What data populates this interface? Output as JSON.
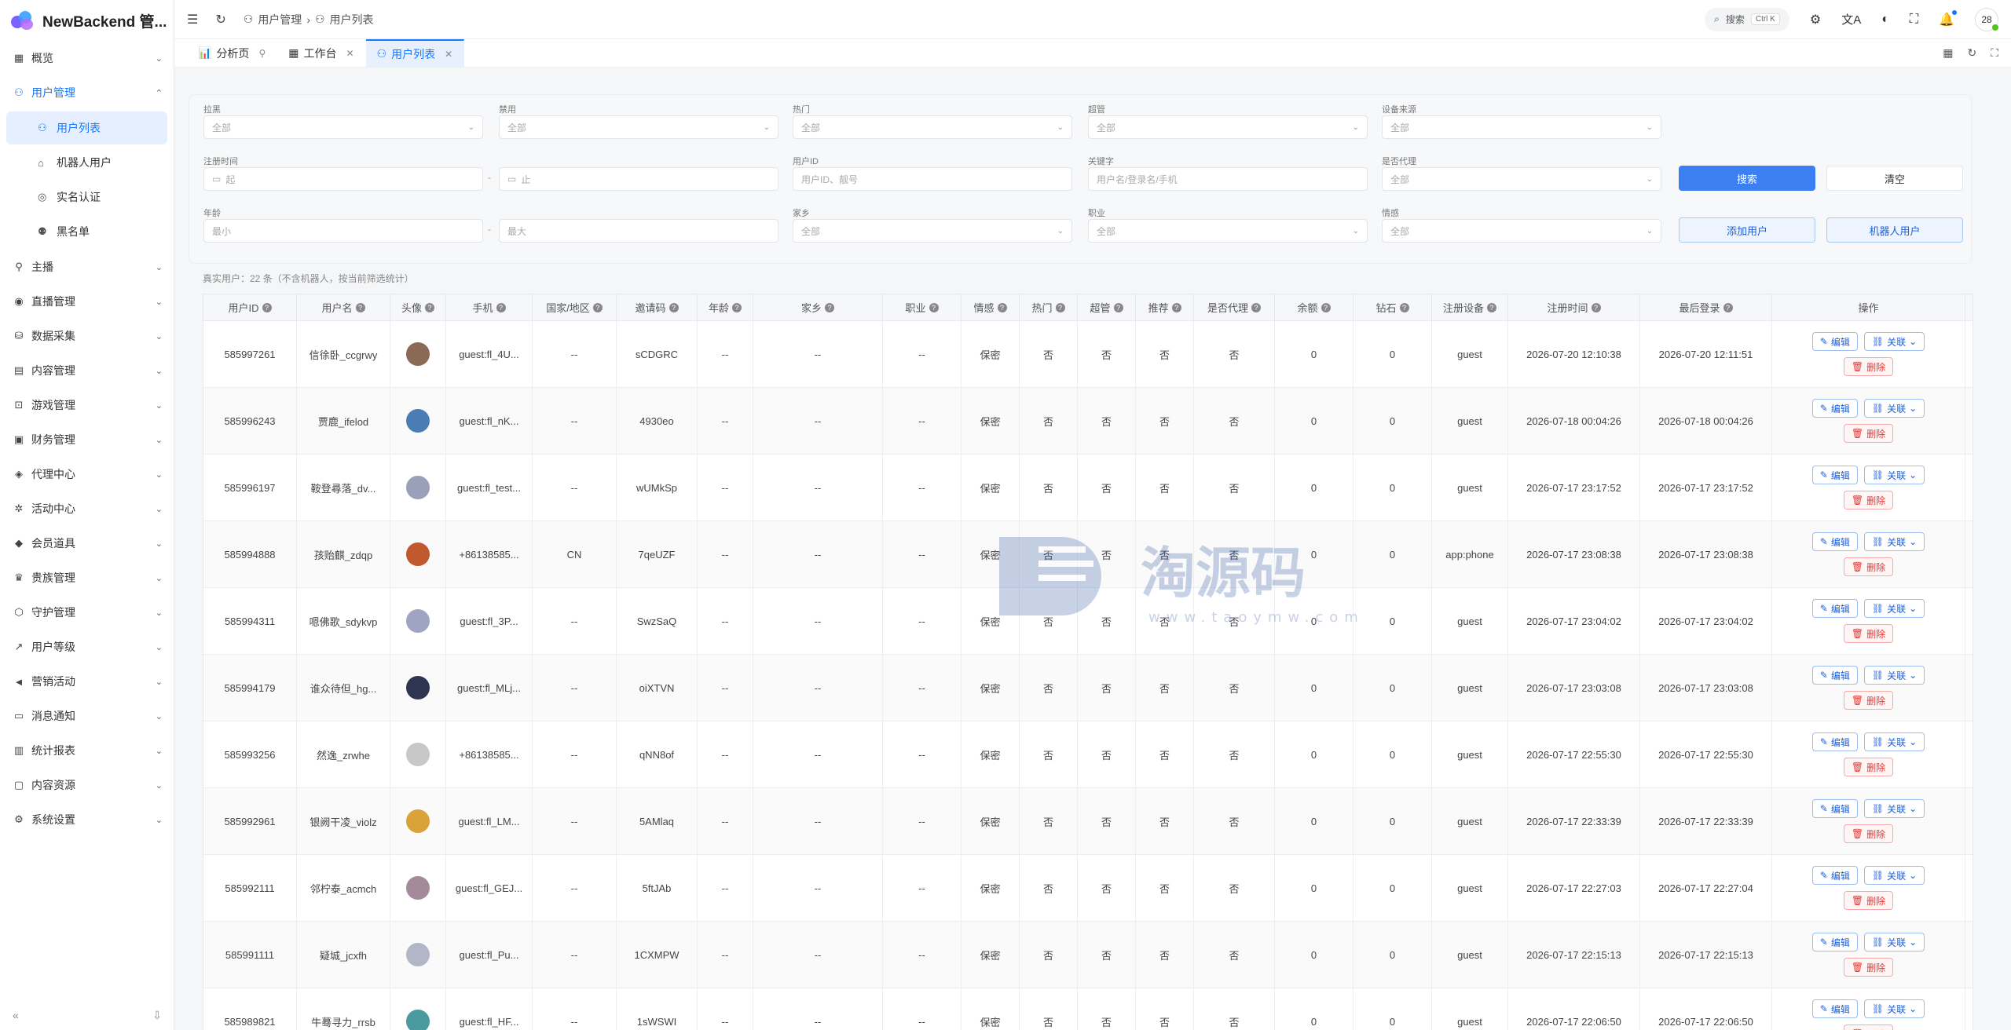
{
  "app": {
    "title": "NewBackend 管...",
    "colors": {
      "accent": "#1677ff",
      "primary_btn": "#3b7ff3",
      "danger": "#e53935"
    }
  },
  "sidebar": {
    "items": [
      {
        "label": "概览",
        "icon": "dashboard-icon"
      },
      {
        "label": "用户管理",
        "icon": "user-icon",
        "expanded": true,
        "children": [
          {
            "label": "用户列表",
            "icon": "user-icon",
            "active": true
          },
          {
            "label": "机器人用户",
            "icon": "robot-icon"
          },
          {
            "label": "实名认证",
            "icon": "fingerprint-icon"
          },
          {
            "label": "黑名单",
            "icon": "user-block-icon"
          }
        ]
      },
      {
        "label": "主播",
        "icon": "mic-icon"
      },
      {
        "label": "直播管理",
        "icon": "broadcast-icon"
      },
      {
        "label": "数据采集",
        "icon": "database-icon"
      },
      {
        "label": "内容管理",
        "icon": "content-icon"
      },
      {
        "label": "游戏管理",
        "icon": "gamepad-icon"
      },
      {
        "label": "财务管理",
        "icon": "wallet-icon"
      },
      {
        "label": "代理中心",
        "icon": "shield-icon"
      },
      {
        "label": "活动中心",
        "icon": "gift-icon"
      },
      {
        "label": "会员道具",
        "icon": "diamond-icon"
      },
      {
        "label": "贵族管理",
        "icon": "crown-icon"
      },
      {
        "label": "守护管理",
        "icon": "guard-icon"
      },
      {
        "label": "用户等级",
        "icon": "trend-icon"
      },
      {
        "label": "营销活动",
        "icon": "megaphone-icon"
      },
      {
        "label": "消息通知",
        "icon": "message-icon"
      },
      {
        "label": "统计报表",
        "icon": "chart-icon"
      },
      {
        "label": "内容资源",
        "icon": "folder-icon"
      },
      {
        "label": "系统设置",
        "icon": "gear-icon"
      }
    ],
    "collapse": "«",
    "pin": "⇩"
  },
  "topbar": {
    "breadcrumb": [
      "用户管理",
      "用户列表"
    ],
    "search_label": "搜索",
    "search_kbd": "Ctrl K",
    "avatar_text": "28"
  },
  "tabs": [
    {
      "label": "分析页",
      "icon": "chart-icon",
      "pin": true
    },
    {
      "label": "工作台",
      "icon": "grid-icon",
      "closable": true
    },
    {
      "label": "用户列表",
      "icon": "user-icon",
      "closable": true,
      "active": true
    }
  ],
  "filters": {
    "row1": [
      {
        "label": "拉黑",
        "placeholder": "全部",
        "type": "select"
      },
      {
        "label": "禁用",
        "placeholder": "全部",
        "type": "select"
      },
      {
        "label": "热门",
        "placeholder": "全部",
        "type": "select"
      },
      {
        "label": "超管",
        "placeholder": "全部",
        "type": "select"
      },
      {
        "label": "设备来源",
        "placeholder": "全部",
        "type": "select"
      }
    ],
    "reg_time": {
      "label": "注册时间",
      "start": "起",
      "end": "止",
      "sep": "-"
    },
    "user_id": {
      "label": "用户ID",
      "placeholder": "用户ID、靓号"
    },
    "keyword": {
      "label": "关键字",
      "placeholder": "用户名/登录名/手机"
    },
    "is_agent": {
      "label": "是否代理",
      "placeholder": "全部"
    },
    "age": {
      "label": "年龄",
      "min": "最小",
      "max": "最大",
      "sep": "-"
    },
    "hometown": {
      "label": "家乡",
      "placeholder": "全部"
    },
    "job": {
      "label": "职业",
      "placeholder": "全部"
    },
    "emotion": {
      "label": "情感",
      "placeholder": "全部"
    },
    "search_btn": "搜索",
    "clear_btn": "清空",
    "add_btn": "添加用户",
    "robot_btn": "机器人用户"
  },
  "summary": "真实用户：22 条（不含机器人，按当前筛选统计）",
  "table": {
    "columns": [
      "用户ID",
      "用户名",
      "头像",
      "手机",
      "国家/地区",
      "邀请码",
      "年龄",
      "家乡",
      "职业",
      "情感",
      "热门",
      "超管",
      "推荐",
      "是否代理",
      "余额",
      "钻石",
      "注册设备",
      "注册时间",
      "最后登录",
      "操作"
    ],
    "ops": {
      "edit": "编辑",
      "link": "关联",
      "delete": "删除"
    },
    "rows": [
      {
        "id": "585997261",
        "name": "信徐卧_ccgrwy",
        "avatar": "#8a6a55",
        "phone": "guest:fl_4U...",
        "region": "--",
        "invite": "sCDGRC",
        "age": "--",
        "home": "--",
        "job": "--",
        "emotion": "保密",
        "hot": "否",
        "admin": "否",
        "rec": "否",
        "agent": "否",
        "balance": "0",
        "diamond": "0",
        "device": "guest",
        "reg": "2026-07-20 12:10:38",
        "last": "2026-07-20 12:11:51"
      },
      {
        "id": "585996243",
        "name": "贾鹿_ifelod",
        "avatar": "#4b7db5",
        "phone": "guest:fl_nK...",
        "region": "--",
        "invite": "4930eo",
        "age": "--",
        "home": "--",
        "job": "--",
        "emotion": "保密",
        "hot": "否",
        "admin": "否",
        "rec": "否",
        "agent": "否",
        "balance": "0",
        "diamond": "0",
        "device": "guest",
        "reg": "2026-07-18 00:04:26",
        "last": "2026-07-18 00:04:26"
      },
      {
        "id": "585996197",
        "name": "鞍登尋落_dv...",
        "avatar": "#9aa0b8",
        "phone": "guest:fl_test...",
        "region": "--",
        "invite": "wUMkSp",
        "age": "--",
        "home": "--",
        "job": "--",
        "emotion": "保密",
        "hot": "否",
        "admin": "否",
        "rec": "否",
        "agent": "否",
        "balance": "0",
        "diamond": "0",
        "device": "guest",
        "reg": "2026-07-17 23:17:52",
        "last": "2026-07-17 23:17:52"
      },
      {
        "id": "585994888",
        "name": "孩贻麒_zdqp",
        "avatar": "#c0592e",
        "phone": "+86138585...",
        "region": "CN",
        "invite": "7qeUZF",
        "age": "--",
        "home": "--",
        "job": "--",
        "emotion": "保密",
        "hot": "否",
        "admin": "否",
        "rec": "否",
        "agent": "否",
        "balance": "0",
        "diamond": "0",
        "device": "app:phone",
        "reg": "2026-07-17 23:08:38",
        "last": "2026-07-17 23:08:38"
      },
      {
        "id": "585994311",
        "name": "嗯佛歌_sdykvp",
        "avatar": "#a0a4c4",
        "phone": "guest:fl_3P...",
        "region": "--",
        "invite": "SwzSaQ",
        "age": "--",
        "home": "--",
        "job": "--",
        "emotion": "保密",
        "hot": "否",
        "admin": "否",
        "rec": "否",
        "agent": "否",
        "balance": "0",
        "diamond": "0",
        "device": "guest",
        "reg": "2026-07-17 23:04:02",
        "last": "2026-07-17 23:04:02"
      },
      {
        "id": "585994179",
        "name": "谁众待但_hg...",
        "avatar": "#2e3550",
        "phone": "guest:fl_MLj...",
        "region": "--",
        "invite": "oiXTVN",
        "age": "--",
        "home": "--",
        "job": "--",
        "emotion": "保密",
        "hot": "否",
        "admin": "否",
        "rec": "否",
        "agent": "否",
        "balance": "0",
        "diamond": "0",
        "device": "guest",
        "reg": "2026-07-17 23:03:08",
        "last": "2026-07-17 23:03:08"
      },
      {
        "id": "585993256",
        "name": "然逸_zrwhe",
        "avatar": "#c8c8c8",
        "phone": "+86138585...",
        "region": "--",
        "invite": "qNN8of",
        "age": "--",
        "home": "--",
        "job": "--",
        "emotion": "保密",
        "hot": "否",
        "admin": "否",
        "rec": "否",
        "agent": "否",
        "balance": "0",
        "diamond": "0",
        "device": "guest",
        "reg": "2026-07-17 22:55:30",
        "last": "2026-07-17 22:55:30"
      },
      {
        "id": "585992961",
        "name": "银阙干凌_violz",
        "avatar": "#d9a23a",
        "phone": "guest:fl_LM...",
        "region": "--",
        "invite": "5AMlaq",
        "age": "--",
        "home": "--",
        "job": "--",
        "emotion": "保密",
        "hot": "否",
        "admin": "否",
        "rec": "否",
        "agent": "否",
        "balance": "0",
        "diamond": "0",
        "device": "guest",
        "reg": "2026-07-17 22:33:39",
        "last": "2026-07-17 22:33:39"
      },
      {
        "id": "585992111",
        "name": "邻柠泰_acmch",
        "avatar": "#a48a9a",
        "phone": "guest:fl_GEJ...",
        "region": "--",
        "invite": "5ftJAb",
        "age": "--",
        "home": "--",
        "job": "--",
        "emotion": "保密",
        "hot": "否",
        "admin": "否",
        "rec": "否",
        "agent": "否",
        "balance": "0",
        "diamond": "0",
        "device": "guest",
        "reg": "2026-07-17 22:27:03",
        "last": "2026-07-17 22:27:04"
      },
      {
        "id": "585991111",
        "name": "疑城_jcxfh",
        "avatar": "#b2b6c6",
        "phone": "guest:fl_Pu...",
        "region": "--",
        "invite": "1CXMPW",
        "age": "--",
        "home": "--",
        "job": "--",
        "emotion": "保密",
        "hot": "否",
        "admin": "否",
        "rec": "否",
        "agent": "否",
        "balance": "0",
        "diamond": "0",
        "device": "guest",
        "reg": "2026-07-17 22:15:13",
        "last": "2026-07-17 22:15:13"
      },
      {
        "id": "585989821",
        "name": "牛蓦寻力_rrsb",
        "avatar": "#4a9aa0",
        "phone": "guest:fl_HF...",
        "region": "--",
        "invite": "1sWSWI",
        "age": "--",
        "home": "--",
        "job": "--",
        "emotion": "保密",
        "hot": "否",
        "admin": "否",
        "rec": "否",
        "agent": "否",
        "balance": "0",
        "diamond": "0",
        "device": "guest",
        "reg": "2026-07-17 22:06:50",
        "last": "2026-07-17 22:06:50"
      }
    ]
  },
  "watermark": {
    "text": "淘源码",
    "url": "www.taoymw.com"
  }
}
